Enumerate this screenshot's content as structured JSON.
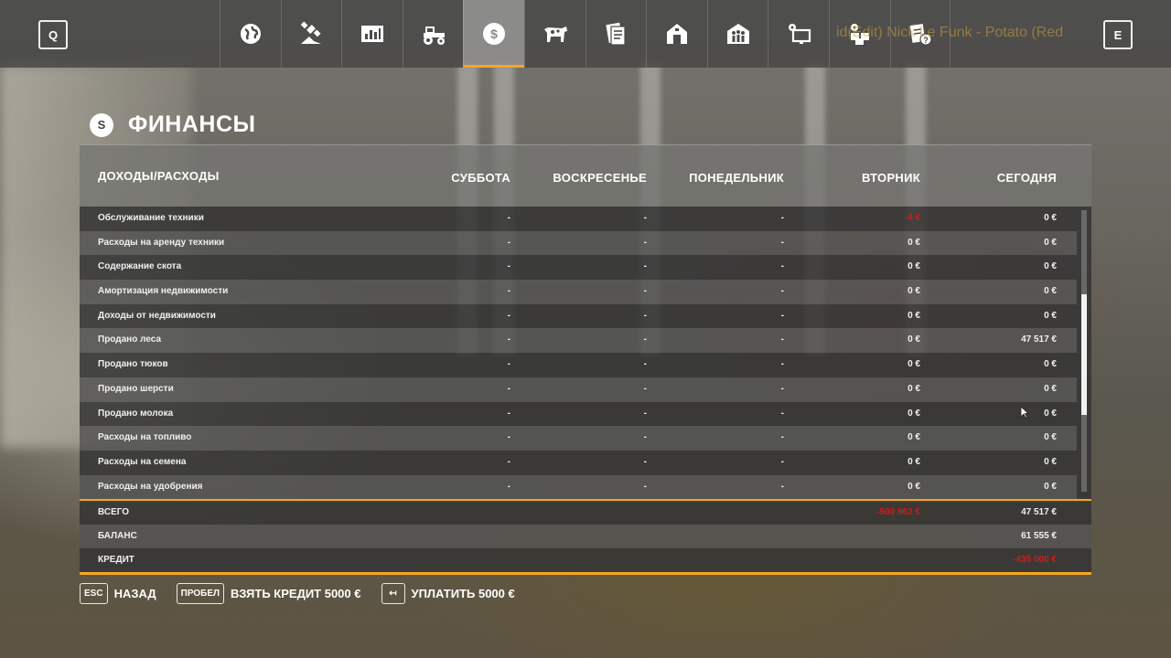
{
  "topbar": {
    "quick_key": "Q",
    "end_key": "E",
    "overlay_text": "id(Edit)  Nick Le Funk - Potato (Red",
    "tabs": [
      {
        "name": "map",
        "icon": "globe-icon",
        "active": false
      },
      {
        "name": "calendar",
        "icon": "satellite-field-icon",
        "active": false
      },
      {
        "name": "prices",
        "icon": "chart-icon",
        "active": false
      },
      {
        "name": "vehicles",
        "icon": "tractor-icon",
        "active": false
      },
      {
        "name": "finances",
        "icon": "dollar-icon",
        "active": true
      },
      {
        "name": "animals",
        "icon": "cow-icon",
        "active": false
      },
      {
        "name": "contracts",
        "icon": "documents-icon",
        "active": false
      },
      {
        "name": "farms",
        "icon": "barn-icon",
        "active": false
      },
      {
        "name": "players",
        "icon": "people-icon",
        "active": false
      },
      {
        "name": "settings",
        "icon": "monitor-settings-icon",
        "active": false
      },
      {
        "name": "production",
        "icon": "factory-icon",
        "active": false
      },
      {
        "name": "help",
        "icon": "help-icon",
        "active": false
      }
    ]
  },
  "page": {
    "icon_letter": "S",
    "title": "ФИНАНСЫ"
  },
  "table": {
    "headers": [
      "ДОХОДЫ/РАСХОДЫ",
      "СУББОТА",
      "ВОСКРЕСЕНЬЕ",
      "ПОНЕДЕЛЬНИК",
      "ВТОРНИК",
      "СЕГОДНЯ"
    ],
    "rows": [
      {
        "label": "Обслуживание техники",
        "values": [
          "-",
          "-",
          "-",
          "-4 €",
          "0 €"
        ],
        "negative": [
          false,
          false,
          false,
          true,
          false
        ]
      },
      {
        "label": "Расходы на аренду техники",
        "values": [
          "-",
          "-",
          "-",
          "0 €",
          "0 €"
        ],
        "negative": [
          false,
          false,
          false,
          false,
          false
        ]
      },
      {
        "label": "Содержание скота",
        "values": [
          "-",
          "-",
          "-",
          "0 €",
          "0 €"
        ],
        "negative": [
          false,
          false,
          false,
          false,
          false
        ]
      },
      {
        "label": "Амортизация недвижимости",
        "values": [
          "-",
          "-",
          "-",
          "0 €",
          "0 €"
        ],
        "negative": [
          false,
          false,
          false,
          false,
          false
        ]
      },
      {
        "label": "Доходы от недвижимости",
        "values": [
          "-",
          "-",
          "-",
          "0 €",
          "0 €"
        ],
        "negative": [
          false,
          false,
          false,
          false,
          false
        ]
      },
      {
        "label": "Продано леса",
        "values": [
          "-",
          "-",
          "-",
          "0 €",
          "47 517 €"
        ],
        "negative": [
          false,
          false,
          false,
          false,
          false
        ]
      },
      {
        "label": "Продано тюков",
        "values": [
          "-",
          "-",
          "-",
          "0 €",
          "0 €"
        ],
        "negative": [
          false,
          false,
          false,
          false,
          false
        ]
      },
      {
        "label": "Продано шерсти",
        "values": [
          "-",
          "-",
          "-",
          "0 €",
          "0 €"
        ],
        "negative": [
          false,
          false,
          false,
          false,
          false
        ]
      },
      {
        "label": "Продано молока",
        "values": [
          "-",
          "-",
          "-",
          "0 €",
          "0 €"
        ],
        "negative": [
          false,
          false,
          false,
          false,
          false
        ]
      },
      {
        "label": "Расходы на топливо",
        "values": [
          "-",
          "-",
          "-",
          "0 €",
          "0 €"
        ],
        "negative": [
          false,
          false,
          false,
          false,
          false
        ]
      },
      {
        "label": "Расходы на семена",
        "values": [
          "-",
          "-",
          "-",
          "0 €",
          "0 €"
        ],
        "negative": [
          false,
          false,
          false,
          false,
          false
        ]
      },
      {
        "label": "Расходы на удобрения",
        "values": [
          "-",
          "-",
          "-",
          "0 €",
          "0 €"
        ],
        "negative": [
          false,
          false,
          false,
          false,
          false
        ]
      }
    ],
    "totals": [
      {
        "label": "ВСЕГО",
        "tuesday": "-500 962 €",
        "tuesday_negative": true,
        "today": "47 517 €",
        "today_negative": false
      },
      {
        "label": "БАЛАНС",
        "tuesday": "",
        "tuesday_negative": false,
        "today": "61 555 €",
        "today_negative": false
      },
      {
        "label": "КРЕДИТ",
        "tuesday": "",
        "tuesday_negative": false,
        "today": "-435 000 €",
        "today_negative": true
      }
    ]
  },
  "footer": {
    "back": {
      "key": "ESC",
      "label": "НАЗАД"
    },
    "take_loan": {
      "key": "ПРОБЕЛ",
      "label": "ВЗЯТЬ КРЕДИТ 5000 €"
    },
    "repay": {
      "key": "↤",
      "label": "УПЛАТИТЬ 5000 €"
    }
  },
  "colors": {
    "accent": "#f5a623",
    "negative": "#d01b1b"
  }
}
